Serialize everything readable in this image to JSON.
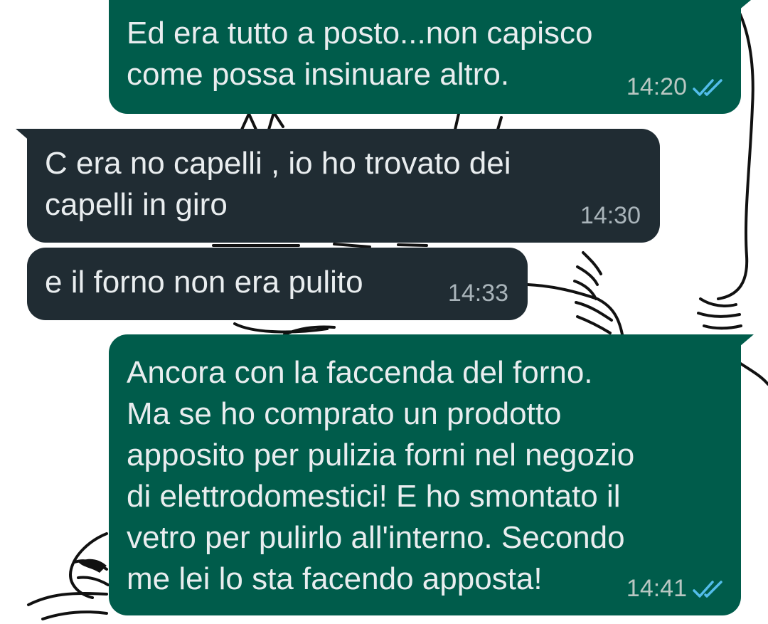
{
  "conversation": {
    "messages": [
      {
        "direction": "outgoing",
        "text": "Ed era tutto a posto...non capisco\ncome possa insinuare altro.",
        "time": "14:20",
        "status": "read"
      },
      {
        "direction": "incoming",
        "text": "C era no capelli , io ho trovato dei\ncapelli in giro",
        "time": "14:30"
      },
      {
        "direction": "incoming",
        "text": "e il forno non era pulito",
        "time": "14:33"
      },
      {
        "direction": "outgoing",
        "text": "Ancora con la faccenda del forno.\nMa se ho comprato un prodotto\napposito per pulizia forni nel negozio\ndi elettrodomestici! E ho smontato il\nvetro per pulirlo all'interno. Secondo\nme lei lo sta facendo apposta!",
        "time": "14:41",
        "status": "read"
      }
    ]
  },
  "colors": {
    "outgoing_bubble": "#005c4b",
    "incoming_bubble": "#202c33",
    "message_text": "#e9edef",
    "read_ticks": "#53bdeb",
    "wallpaper": "#ffffff"
  },
  "icons": {
    "read_receipt": "double-check-icon"
  }
}
